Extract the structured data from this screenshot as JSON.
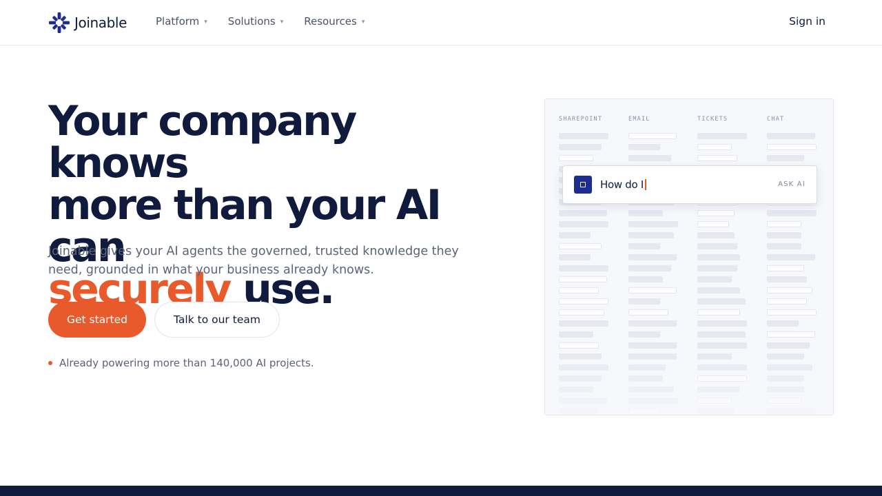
{
  "brand": {
    "name": "Joinable",
    "logo_icon": "starburst-logo-icon",
    "logo_color": "#1d2c8f"
  },
  "nav": {
    "items": [
      {
        "label": "Platform",
        "caret": "▾"
      },
      {
        "label": "Solutions",
        "caret": "▾"
      },
      {
        "label": "Resources",
        "caret": "▾"
      }
    ],
    "sign_in": "Sign in"
  },
  "hero": {
    "headline_line1": "Your company knows",
    "headline_line2": "more than your AI can",
    "headline_accent": "securely",
    "headline_tail": "use.",
    "subtext": "Joinable gives your AI agents the governed, trusted knowledge they need, grounded in what your business already knows.",
    "primary_cta": "Get started",
    "secondary_cta": "Talk to our team",
    "proof_text": "Already powering more than 140,000 AI projects."
  },
  "illustration": {
    "sources": [
      "SHAREPOINT",
      "EMAIL",
      "TICKETS",
      "CHAT"
    ],
    "ask_box": {
      "query": "How do I",
      "label": "ASK AI",
      "icon": "square-app-icon"
    }
  },
  "colors": {
    "navy": "#0f1a3d",
    "accent_orange": "#e8592b",
    "muted_text": "#5b6478",
    "panel_bg": "#f7f8fb",
    "footer_band": "#0f1a3d"
  }
}
